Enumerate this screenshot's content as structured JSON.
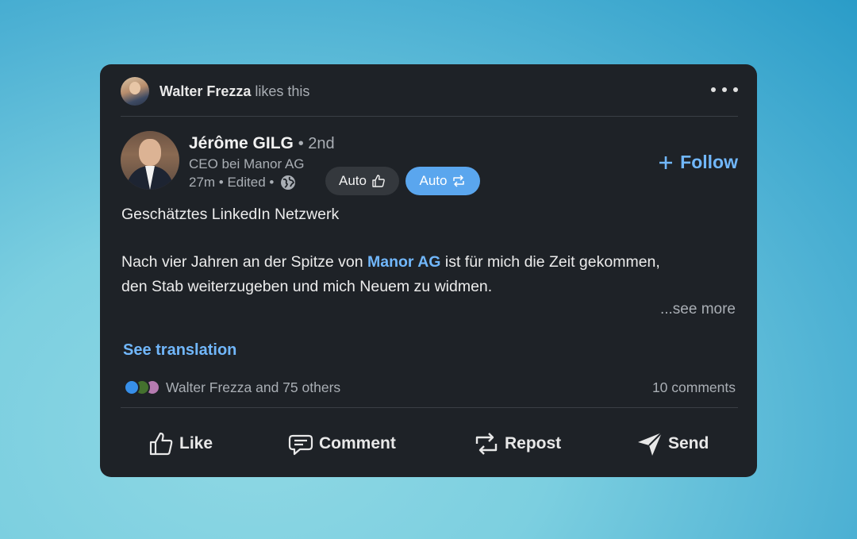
{
  "social_header": {
    "actor_name": "Walter Frezza",
    "action_text": "likes this",
    "more_icon": "ellipsis-icon"
  },
  "author": {
    "name": "Jérôme GILG",
    "degree": "• 2nd",
    "headline": "CEO bei Manor AG",
    "meta": "27m • Edited •",
    "visibility_icon": "globe-icon",
    "follow_label": "Follow"
  },
  "quick_actions": {
    "auto_like_label": "Auto",
    "auto_repost_label": "Auto"
  },
  "post": {
    "line1": "Geschätztes LinkedIn Netzwerk",
    "para2_before": "Nach vier Jahren an der Spitze von ",
    "mention": "Manor AG",
    "para2_after": " ist für mich die Zeit gekommen,",
    "para2_line2": "den Stab weiterzugeben und mich Neuem zu widmen.",
    "see_more": "...see more",
    "see_translation": "See translation"
  },
  "engagement": {
    "reactions_text": "Walter Frezza and 75 others",
    "comments_text": "10 comments",
    "reaction_icons": [
      "like-reaction-icon",
      "celebrate-reaction-icon",
      "love-reaction-icon"
    ]
  },
  "actions": {
    "like": "Like",
    "comment": "Comment",
    "repost": "Repost",
    "send": "Send"
  },
  "colors": {
    "card_bg": "#1e2227",
    "link_blue": "#71b7fb",
    "pill_blue": "#5aa6ee",
    "muted_text": "#a9aeb4"
  }
}
